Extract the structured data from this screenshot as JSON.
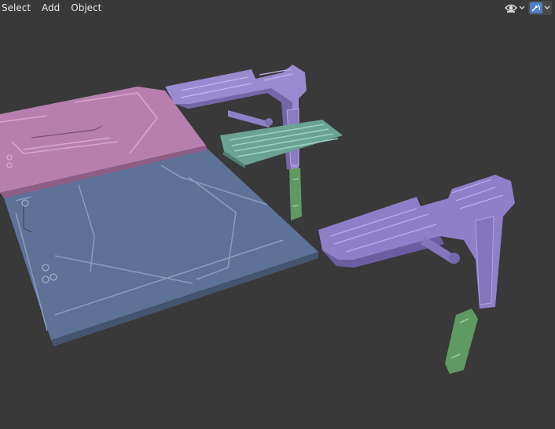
{
  "header": {
    "menu": [
      {
        "label": "Select"
      },
      {
        "label": "Add"
      },
      {
        "label": "Object"
      }
    ],
    "tools": [
      {
        "icon": "visibility-eye-icon"
      },
      {
        "icon": "gizmo-icon"
      }
    ]
  },
  "viewport": {
    "background": "#393939",
    "objects": [
      {
        "name": "floor-panel-pink",
        "color": "#b77fae"
      },
      {
        "name": "floor-panel-blue",
        "color": "#5e7298"
      },
      {
        "name": "bracket-arm-left",
        "color": "#9a8ad0"
      },
      {
        "name": "grate-panel",
        "color": "#6aa394"
      },
      {
        "name": "small-bar-green",
        "color": "#5f9a63"
      },
      {
        "name": "bracket-arm-right",
        "color": "#8f7fc8"
      },
      {
        "name": "long-bar-green",
        "color": "#5f9a63"
      }
    ]
  }
}
